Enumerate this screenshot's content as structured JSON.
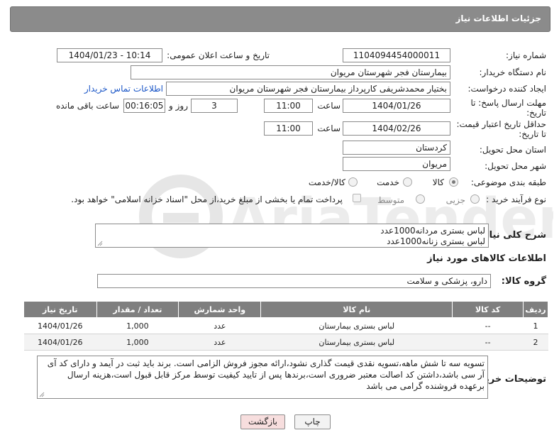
{
  "header": {
    "title": "جزئیات اطلاعات نیاز"
  },
  "form": {
    "need_number_label": "شماره نیاز:",
    "need_number": "1104094454000011",
    "announce_label": "تاریخ و ساعت اعلان عمومی:",
    "announce_value": "1404/01/23 - 10:14",
    "buyer_org_label": "نام دستگاه خریدار:",
    "buyer_org": "بیمارستان فجر شهرستان مریوان",
    "creator_label": "ایجاد کننده درخواست:",
    "creator": "بختیار محمدشریفی کارپرداز بیمارستان فجر شهرستان مریوان",
    "contact_link": "اطلاعات تماس خریدار",
    "deadline_label_1": "مهلت ارسال پاسخ: تا",
    "deadline_label_2": "تاریخ:",
    "deadline_date": "1404/01/26",
    "time_label": "ساعت",
    "deadline_time": "11:00",
    "days_value": "3",
    "days_label": "روز و",
    "remaining_time": "00:16:05",
    "remaining_label": "ساعت باقی مانده",
    "validity_label_1": "حداقل تاریخ اعتبار قیمت:",
    "validity_label_2": "تا تاریخ:",
    "validity_date": "1404/02/26",
    "validity_time": "11:00",
    "province_label": "استان محل تحویل:",
    "province": "کردستان",
    "city_label": "شهر محل تحویل:",
    "city": "مریوان",
    "category_label": "طبقه بندی موضوعی:",
    "category_options": [
      "کالا",
      "خدمت",
      "کالا/خدمت"
    ],
    "process_label": "نوع فرآیند خرید :",
    "process_options": [
      "جزیی",
      "متوسط"
    ],
    "payment_note": "پرداخت تمام یا بخشی از مبلغ خرید،از محل \"اسناد خزانه اسلامی\" خواهد بود."
  },
  "summary": {
    "label": "شرح کلی نیاز:",
    "line1": "لباس بستری مردانه1000عدد",
    "line2": "لباس بستری زنانه1000عدد"
  },
  "goods": {
    "section_title": "اطلاعات کالاهای مورد نیاز",
    "group_label": "گروه کالا:",
    "group_value": "دارو، پزشکی و سلامت",
    "columns": [
      "ردیف",
      "کد کالا",
      "نام کالا",
      "واحد شمارش",
      "تعداد / مقدار",
      "تاریخ نیاز"
    ],
    "rows": [
      {
        "idx": "1",
        "code": "--",
        "name": "لباس بستری بیمارستان",
        "unit": "عدد",
        "qty": "1,000",
        "date": "1404/01/26"
      },
      {
        "idx": "2",
        "code": "--",
        "name": "لباس بستری بیمارستان",
        "unit": "عدد",
        "qty": "1,000",
        "date": "1404/01/26"
      }
    ]
  },
  "buyer_notes": {
    "label": "توضیحات خریدار:",
    "text": "تسویه سه تا شش ماهه،تسویه نقدی قیمت گذاری نشود،ارائه مجوز فروش الزامی است. برند باید ثبت در آیمد و دارای کد آی آر سی باشد،داشتن کد اصالت معتبر ضروری است،برندها پس از تایید کیفیت توسط مرکز قابل قبول است،هزینه ارسال برعهده فروشنده گرامی می باشد"
  },
  "buttons": {
    "print": "چاپ",
    "back": "بازگشت"
  },
  "colors": {
    "header_bg": "#8b8b8b",
    "table_header_bg": "#7f7f7f",
    "link": "#1a56c7",
    "back_button_bg": "#f7dede",
    "watermark": "#e9e9e9"
  },
  "watermark": {
    "brand": "AriaTender.neT"
  }
}
